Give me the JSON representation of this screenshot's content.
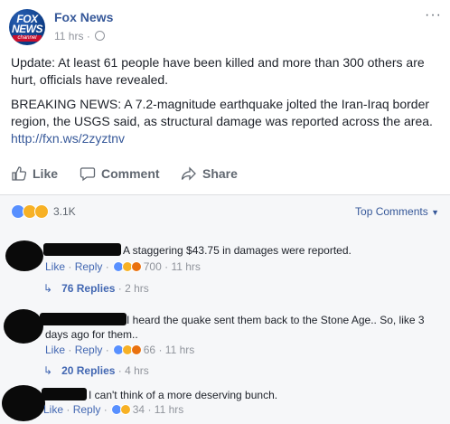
{
  "post": {
    "page_name": "Fox News",
    "logo_text_top": "FOX",
    "logo_text_mid": "NEWS",
    "logo_text_bottom": "channel",
    "time": "11 hrs",
    "dot": "·",
    "more": "···",
    "paragraph1": "Update: At least 61 people have been killed and more than 300 others are hurt, officials have revealed.",
    "paragraph2": "BREAKING NEWS: A 7.2-magnitude earthquake jolted the Iran-Iraq border region, the USGS said, as structural damage was reported across the area.",
    "link": "http://fxn.ws/2zyztnv"
  },
  "actions": {
    "like": "Like",
    "comment": "Comment",
    "share": "Share"
  },
  "reactions": {
    "count": "3.1K",
    "top_comments": "Top Comments"
  },
  "comments": [
    {
      "text": "A staggering $43.75 in damages were reported.",
      "like": "Like",
      "reply": "Reply",
      "sep": "·",
      "reaction_count": "700",
      "time": "11 hrs",
      "replies_label": "76 Replies",
      "replies_time": "2 hrs"
    },
    {
      "text": "I heard the quake sent them back to the Stone Age.. So, like 3 days ago for them..",
      "like": "Like",
      "reply": "Reply",
      "sep": "·",
      "reaction_count": "66",
      "time": "11 hrs",
      "replies_label": "20 Replies",
      "replies_time": "4 hrs"
    },
    {
      "text": "I can't think of a more deserving bunch.",
      "like": "Like",
      "reply": "Reply",
      "sep": "·",
      "reaction_count": "34",
      "time": "11 hrs"
    }
  ],
  "colors": {
    "link": "#365899",
    "meta": "#90949c",
    "action": "#606770",
    "comments_bg": "#f6f7f9"
  }
}
